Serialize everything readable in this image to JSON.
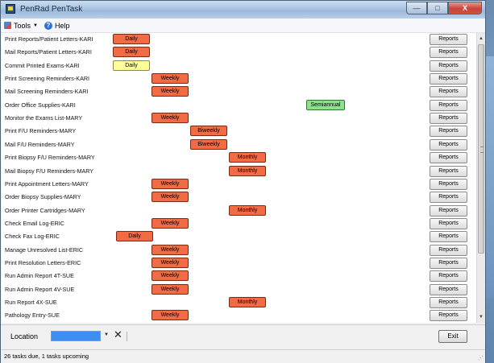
{
  "window": {
    "title": "PenRad PenTask"
  },
  "menu": {
    "tools": "Tools",
    "help": "Help",
    "help_glyph": "?"
  },
  "controls": {
    "minimize": "—",
    "maximize": "□",
    "close": "X"
  },
  "tasks": [
    {
      "label": "Print Reports/Patient Letters-KARI",
      "freq": "Daily",
      "style": "daily-red",
      "action": "Reports"
    },
    {
      "label": "Mail Reports/Patient Letters-KARI",
      "freq": "Daily",
      "style": "daily-red",
      "action": "Reports"
    },
    {
      "label": "Commit Printed Exams-KARI",
      "freq": "Daily",
      "style": "daily-yellow",
      "action": "Reports"
    },
    {
      "label": "Print Screening Reminders-KARI",
      "freq": "Weekly",
      "style": "weekly",
      "action": "Reports"
    },
    {
      "label": "Mail Screening Reminders-KARI",
      "freq": "Weekly",
      "style": "weekly",
      "action": "Reports"
    },
    {
      "label": "Order Office Supplies-KARI",
      "freq": "Semiannual",
      "style": "semiannual",
      "action": "Reports"
    },
    {
      "label": "Monitor the Exams List-MARY",
      "freq": "Weekly",
      "style": "weekly",
      "action": "Reports"
    },
    {
      "label": "Print F/U Reminders-MARY",
      "freq": "Biweekly",
      "style": "biweekly",
      "action": "Reports"
    },
    {
      "label": "Mail F/U Reminders-MARY",
      "freq": "Biweekly",
      "style": "biweekly",
      "action": "Reports"
    },
    {
      "label": "Print Biopsy F/U Reminders-MARY",
      "freq": "Monthly",
      "style": "monthly",
      "action": "Reports"
    },
    {
      "label": "Mail Biopsy F/U Reminders-MARY",
      "freq": "Monthly",
      "style": "monthly",
      "action": "Reports"
    },
    {
      "label": "Print Appointment Letters-MARY",
      "freq": "Weekly",
      "style": "weekly",
      "action": "Reports"
    },
    {
      "label": "Order Biopsy Supplies-MARY",
      "freq": "Weekly",
      "style": "weekly",
      "action": "Reports"
    },
    {
      "label": "Order Printer Cartridges-MARY",
      "freq": "Monthly",
      "style": "monthly",
      "action": "Reports"
    },
    {
      "label": "Check Email Log-ERIC",
      "freq": "Weekly",
      "style": "weekly",
      "action": "Reports"
    },
    {
      "label": "Check Fax Log-ERIC",
      "freq": "Daily",
      "style": "daily-red",
      "action": "Reports"
    },
    {
      "label": "Manage Unresolved List-ERIC",
      "freq": "Weekly",
      "style": "weekly",
      "action": "Reports"
    },
    {
      "label": "Print Resolution Letters-ERIC",
      "freq": "Weekly",
      "style": "weekly",
      "action": "Reports"
    },
    {
      "label": "Run Admin Report 4T-SUE",
      "freq": "Weekly",
      "style": "weekly",
      "action": "Reports"
    },
    {
      "label": "Run Admin Report 4V-SUE",
      "freq": "Weekly",
      "style": "weekly",
      "action": "Reports"
    },
    {
      "label": "Run Report 4X-SUE",
      "freq": "Monthly",
      "style": "monthly",
      "action": "Reports"
    },
    {
      "label": "Pathology Entry-SUE",
      "freq": "Weekly",
      "style": "weekly",
      "action": "Reports"
    }
  ],
  "location": {
    "label": "Location",
    "value": ""
  },
  "exit_label": "Exit",
  "status": "26 tasks due, 1 tasks upcoming"
}
